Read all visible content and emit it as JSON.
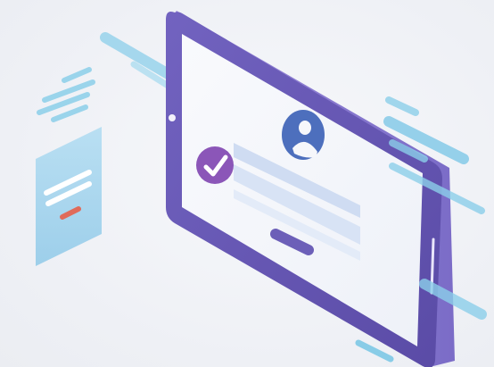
{
  "illustration": {
    "subject": "tablet-login",
    "icons": [
      "user-avatar-icon",
      "checkmark-icon"
    ]
  },
  "colors": {
    "background": "#eef0f5",
    "tablet_frame": "#6a5cb4",
    "tablet_frame_dark": "#4e4294",
    "tablet_edge_light": "#8f7fd3",
    "screen": "#f6f7fb",
    "avatar": "#4d6fbd",
    "check_badge": "#8b56b8",
    "form_field": "#cfdcf2",
    "login_button": "#6c5fb8",
    "accent_cyan": "#6fc4e4",
    "small_card": "#9fd3ee",
    "small_card_button": "#e06b5a"
  }
}
